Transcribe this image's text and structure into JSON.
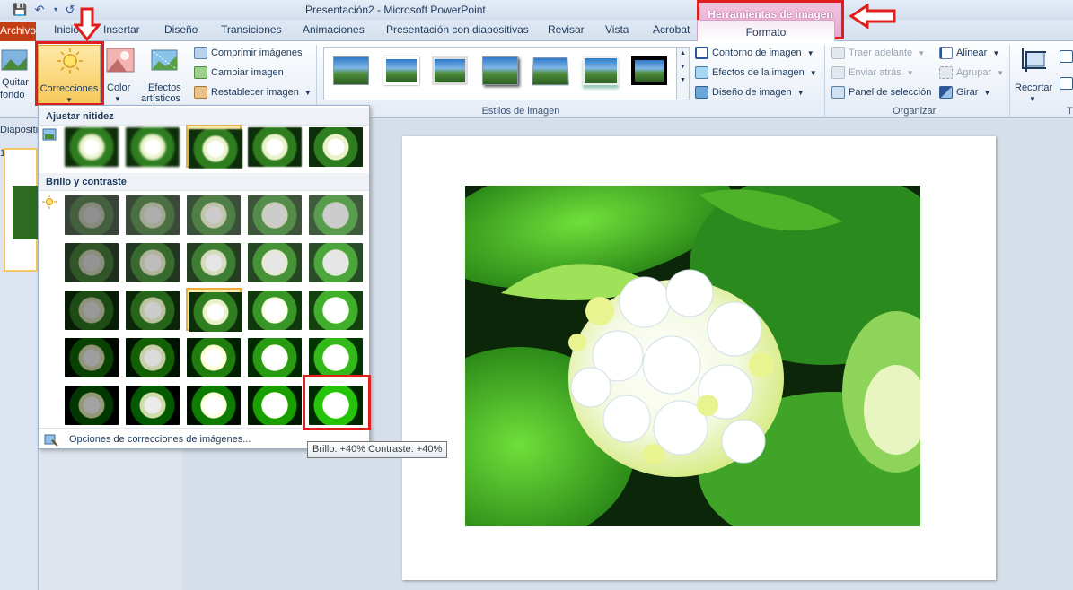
{
  "window": {
    "title": "Presentación2  -  Microsoft PowerPoint"
  },
  "context_header": {
    "label": "Herramientas de imagen"
  },
  "tabs": {
    "archivo": "Archivo",
    "inicio": "Inicio",
    "insertar": "Insertar",
    "diseno": "Diseño",
    "transiciones": "Transiciones",
    "animaciones": "Animaciones",
    "presentacion": "Presentación con diapositivas",
    "revisar": "Revisar",
    "vista": "Vista",
    "acrobat": "Acrobat",
    "formato": "Formato"
  },
  "ribbon": {
    "quitar_fondo_1": "Quitar",
    "quitar_fondo_2": "fondo",
    "correcciones": "Correcciones",
    "color": "Color",
    "efectos_1": "Efectos",
    "efectos_2": "artísticos",
    "comprimir": "Comprimir imágenes",
    "cambiar": "Cambiar imagen",
    "restablecer": "Restablecer imagen",
    "estilos_label": "Estilos de imagen",
    "contorno": "Contorno de imagen",
    "efectos_imagen": "Efectos de la imagen",
    "diseno_imagen": "Diseño de imagen",
    "traer": "Traer adelante",
    "enviar": "Enviar atrás",
    "panel": "Panel de selección",
    "alinear": "Alinear",
    "agrupar": "Agrupar",
    "girar": "Girar",
    "organizar_label": "Organizar",
    "recortar": "Recortar",
    "tamano_label": "T"
  },
  "slides_pane": {
    "label": "Diapositi",
    "slide_number": "1"
  },
  "dropdown": {
    "section_1": "Ajustar nitidez",
    "section_2": "Brillo y contraste",
    "footer": "Opciones de correcciones de imágenes..."
  },
  "tooltip": "Brillo: +40% Contraste: +40%",
  "colors": {
    "accent_red": "#e01e1e",
    "selection_gold": "#e6b23c",
    "context_pink": "#e9a9d0"
  }
}
